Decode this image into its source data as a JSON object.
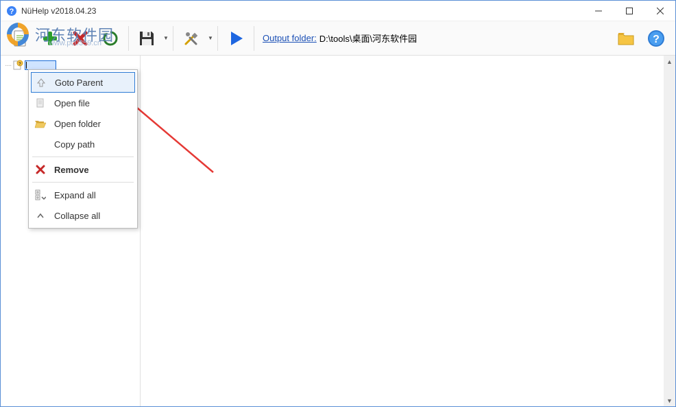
{
  "window": {
    "title": "NüHelp v2018.04.23"
  },
  "toolbar": {
    "output_label": "Output folder:",
    "output_path": "D:\\tools\\桌面\\河东软件园"
  },
  "context_menu": {
    "items": [
      {
        "label": "Goto Parent",
        "icon": "up-icon",
        "selected": true
      },
      {
        "label": "Open file",
        "icon": "file-icon"
      },
      {
        "label": "Open folder",
        "icon": "folder-open-icon"
      },
      {
        "label": "Copy path",
        "icon": ""
      },
      {
        "sep": true
      },
      {
        "label": "Remove",
        "icon": "remove-icon",
        "bold": true
      },
      {
        "sep": true
      },
      {
        "label": "Expand all",
        "icon": "expand-icon"
      },
      {
        "label": "Collapse all",
        "icon": "collapse-icon"
      }
    ]
  },
  "watermark": {
    "text": "河东软件园",
    "sub": "www.pc0359.cn"
  }
}
